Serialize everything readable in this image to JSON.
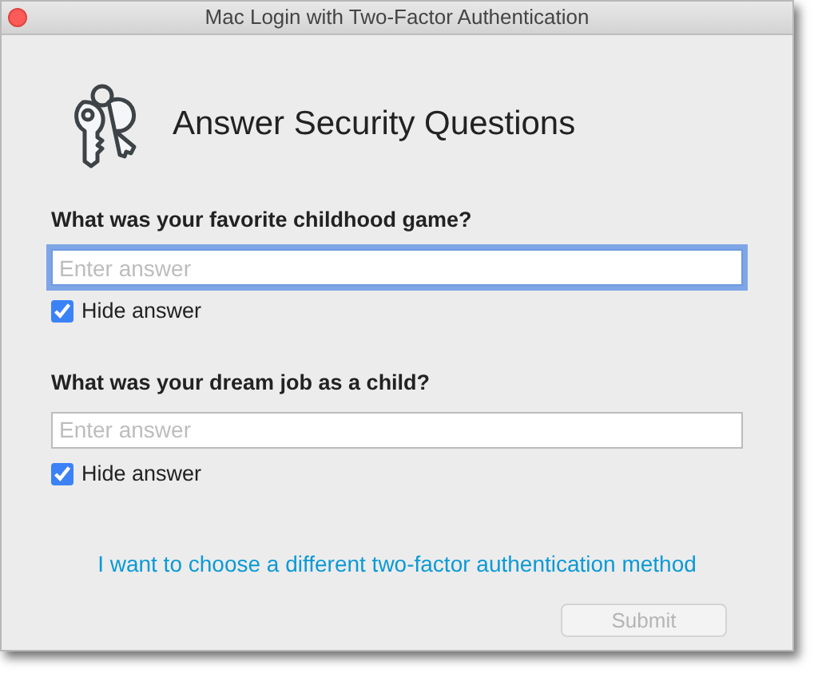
{
  "window": {
    "title": "Mac Login with Two-Factor Authentication"
  },
  "heading": "Answer Security Questions",
  "questions": [
    {
      "label": "What was your favorite childhood game?",
      "placeholder": "Enter answer",
      "focused": true,
      "hide_label": "Hide answer",
      "checked": true
    },
    {
      "label": "What was your dream job as a child?",
      "placeholder": "Enter answer",
      "focused": false,
      "hide_label": "Hide answer",
      "checked": true
    }
  ],
  "link": "I want to choose a different two-factor authentication method",
  "submit": {
    "label": "Submit",
    "disabled": true
  }
}
